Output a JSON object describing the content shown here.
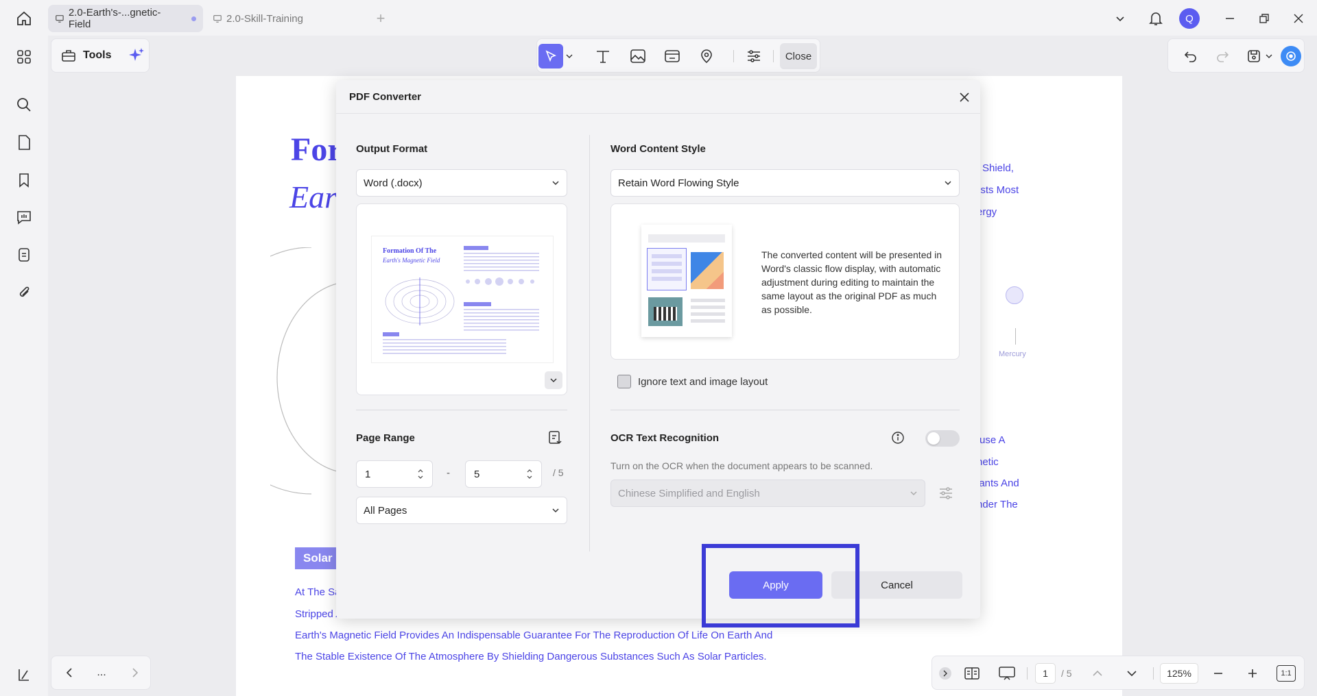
{
  "tabs": [
    {
      "label": "2.0-Earth's-...gnetic-Field",
      "active": true
    },
    {
      "label": "2.0-Skill-Training",
      "active": false
    }
  ],
  "avatar_letter": "Q",
  "toolbar": {
    "tools_label": "Tools",
    "close_label": "Close"
  },
  "document": {
    "title_line1": "For",
    "title_line2": "Ear",
    "right_lines": [
      "Shield,",
      "ists Most",
      "ergy"
    ],
    "planet_label": "Mercury",
    "right_lines2": [
      "use A",
      "netic",
      "lants And",
      "nder The"
    ],
    "section_badge": "Solar",
    "body_partial": [
      "At The Sa",
      "Stripped A"
    ],
    "body_lines": [
      "Earth's Magnetic Field Provides An Indispensable Guarantee For The Reproduction Of Life On Earth And",
      "The Stable Existence Of The Atmosphere By Shielding Dangerous Substances Such As Solar Particles."
    ]
  },
  "dialog": {
    "title": "PDF Converter",
    "output_format": {
      "heading": "Output Format",
      "selected": "Word (.docx)",
      "thumb_title1": "Formation Of The",
      "thumb_title2": "Earth's Magnetic Field"
    },
    "word_style": {
      "heading": "Word Content Style",
      "selected": "Retain Word Flowing Style",
      "description": "The converted content will be presented in Word's classic flow display, with automatic adjustment during editing to maintain the same layout as the original PDF as much as possible."
    },
    "ignore_layout": {
      "label": "Ignore text and image layout",
      "checked": false
    },
    "page_range": {
      "heading": "Page Range",
      "from": "1",
      "to": "5",
      "separator": "-",
      "total": "/ 5",
      "mode": "All Pages"
    },
    "ocr": {
      "heading": "OCR Text Recognition",
      "enabled": false,
      "hint": "Turn on the OCR when the document appears to be scanned.",
      "language": "Chinese Simplified and English"
    },
    "apply_label": "Apply",
    "cancel_label": "Cancel"
  },
  "bottom": {
    "nav_more": "...",
    "page_current": "1",
    "page_total": "/ 5",
    "zoom": "125%",
    "fit_label": "1:1"
  },
  "colors": {
    "accent": "#6a6cf2",
    "highlight_box": "#3b3bd6",
    "doc_text": "#4b44e6"
  }
}
